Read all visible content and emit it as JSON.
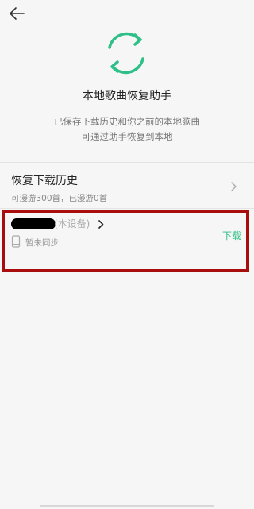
{
  "header": {
    "back_icon": "arrow-left-icon"
  },
  "hero": {
    "icon": "sync-arrows-icon",
    "accent_color": "#2fbf88",
    "title": "本地歌曲恢复助手",
    "desc_line1": "已保存下载历史和你之前的本地歌曲",
    "desc_line2": "可通过助手恢复到本地"
  },
  "history": {
    "title": "恢复下载历史",
    "subtitle": "可漫游300首，已漫游0首",
    "chevron_icon": "chevron-right-icon"
  },
  "device": {
    "name_suffix": "(本设备)",
    "chevron_icon": "chevron-right-icon",
    "phone_icon": "phone-icon",
    "sync_status": "暂未同步",
    "download_label": "下载",
    "highlight_color": "#a90e0e"
  }
}
